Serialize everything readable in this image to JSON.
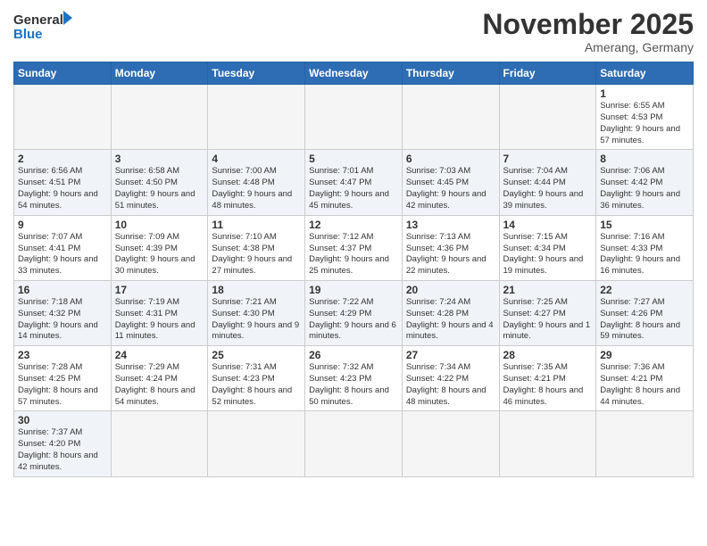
{
  "logo": {
    "general": "General",
    "blue": "Blue"
  },
  "header": {
    "month": "November 2025",
    "location": "Amerang, Germany"
  },
  "weekdays": [
    "Sunday",
    "Monday",
    "Tuesday",
    "Wednesday",
    "Thursday",
    "Friday",
    "Saturday"
  ],
  "weeks": [
    [
      {
        "day": "",
        "info": ""
      },
      {
        "day": "",
        "info": ""
      },
      {
        "day": "",
        "info": ""
      },
      {
        "day": "",
        "info": ""
      },
      {
        "day": "",
        "info": ""
      },
      {
        "day": "",
        "info": ""
      },
      {
        "day": "1",
        "info": "Sunrise: 6:55 AM\nSunset: 4:53 PM\nDaylight: 9 hours\nand 57 minutes."
      }
    ],
    [
      {
        "day": "2",
        "info": "Sunrise: 6:56 AM\nSunset: 4:51 PM\nDaylight: 9 hours\nand 54 minutes."
      },
      {
        "day": "3",
        "info": "Sunrise: 6:58 AM\nSunset: 4:50 PM\nDaylight: 9 hours\nand 51 minutes."
      },
      {
        "day": "4",
        "info": "Sunrise: 7:00 AM\nSunset: 4:48 PM\nDaylight: 9 hours\nand 48 minutes."
      },
      {
        "day": "5",
        "info": "Sunrise: 7:01 AM\nSunset: 4:47 PM\nDaylight: 9 hours\nand 45 minutes."
      },
      {
        "day": "6",
        "info": "Sunrise: 7:03 AM\nSunset: 4:45 PM\nDaylight: 9 hours\nand 42 minutes."
      },
      {
        "day": "7",
        "info": "Sunrise: 7:04 AM\nSunset: 4:44 PM\nDaylight: 9 hours\nand 39 minutes."
      },
      {
        "day": "8",
        "info": "Sunrise: 7:06 AM\nSunset: 4:42 PM\nDaylight: 9 hours\nand 36 minutes."
      }
    ],
    [
      {
        "day": "9",
        "info": "Sunrise: 7:07 AM\nSunset: 4:41 PM\nDaylight: 9 hours\nand 33 minutes."
      },
      {
        "day": "10",
        "info": "Sunrise: 7:09 AM\nSunset: 4:39 PM\nDaylight: 9 hours\nand 30 minutes."
      },
      {
        "day": "11",
        "info": "Sunrise: 7:10 AM\nSunset: 4:38 PM\nDaylight: 9 hours\nand 27 minutes."
      },
      {
        "day": "12",
        "info": "Sunrise: 7:12 AM\nSunset: 4:37 PM\nDaylight: 9 hours\nand 25 minutes."
      },
      {
        "day": "13",
        "info": "Sunrise: 7:13 AM\nSunset: 4:36 PM\nDaylight: 9 hours\nand 22 minutes."
      },
      {
        "day": "14",
        "info": "Sunrise: 7:15 AM\nSunset: 4:34 PM\nDaylight: 9 hours\nand 19 minutes."
      },
      {
        "day": "15",
        "info": "Sunrise: 7:16 AM\nSunset: 4:33 PM\nDaylight: 9 hours\nand 16 minutes."
      }
    ],
    [
      {
        "day": "16",
        "info": "Sunrise: 7:18 AM\nSunset: 4:32 PM\nDaylight: 9 hours\nand 14 minutes."
      },
      {
        "day": "17",
        "info": "Sunrise: 7:19 AM\nSunset: 4:31 PM\nDaylight: 9 hours\nand 11 minutes."
      },
      {
        "day": "18",
        "info": "Sunrise: 7:21 AM\nSunset: 4:30 PM\nDaylight: 9 hours\nand 9 minutes."
      },
      {
        "day": "19",
        "info": "Sunrise: 7:22 AM\nSunset: 4:29 PM\nDaylight: 9 hours\nand 6 minutes."
      },
      {
        "day": "20",
        "info": "Sunrise: 7:24 AM\nSunset: 4:28 PM\nDaylight: 9 hours\nand 4 minutes."
      },
      {
        "day": "21",
        "info": "Sunrise: 7:25 AM\nSunset: 4:27 PM\nDaylight: 9 hours\nand 1 minute."
      },
      {
        "day": "22",
        "info": "Sunrise: 7:27 AM\nSunset: 4:26 PM\nDaylight: 8 hours\nand 59 minutes."
      }
    ],
    [
      {
        "day": "23",
        "info": "Sunrise: 7:28 AM\nSunset: 4:25 PM\nDaylight: 8 hours\nand 57 minutes."
      },
      {
        "day": "24",
        "info": "Sunrise: 7:29 AM\nSunset: 4:24 PM\nDaylight: 8 hours\nand 54 minutes."
      },
      {
        "day": "25",
        "info": "Sunrise: 7:31 AM\nSunset: 4:23 PM\nDaylight: 8 hours\nand 52 minutes."
      },
      {
        "day": "26",
        "info": "Sunrise: 7:32 AM\nSunset: 4:23 PM\nDaylight: 8 hours\nand 50 minutes."
      },
      {
        "day": "27",
        "info": "Sunrise: 7:34 AM\nSunset: 4:22 PM\nDaylight: 8 hours\nand 48 minutes."
      },
      {
        "day": "28",
        "info": "Sunrise: 7:35 AM\nSunset: 4:21 PM\nDaylight: 8 hours\nand 46 minutes."
      },
      {
        "day": "29",
        "info": "Sunrise: 7:36 AM\nSunset: 4:21 PM\nDaylight: 8 hours\nand 44 minutes."
      }
    ],
    [
      {
        "day": "30",
        "info": "Sunrise: 7:37 AM\nSunset: 4:20 PM\nDaylight: 8 hours\nand 42 minutes."
      },
      {
        "day": "",
        "info": ""
      },
      {
        "day": "",
        "info": ""
      },
      {
        "day": "",
        "info": ""
      },
      {
        "day": "",
        "info": ""
      },
      {
        "day": "",
        "info": ""
      },
      {
        "day": "",
        "info": ""
      }
    ]
  ]
}
